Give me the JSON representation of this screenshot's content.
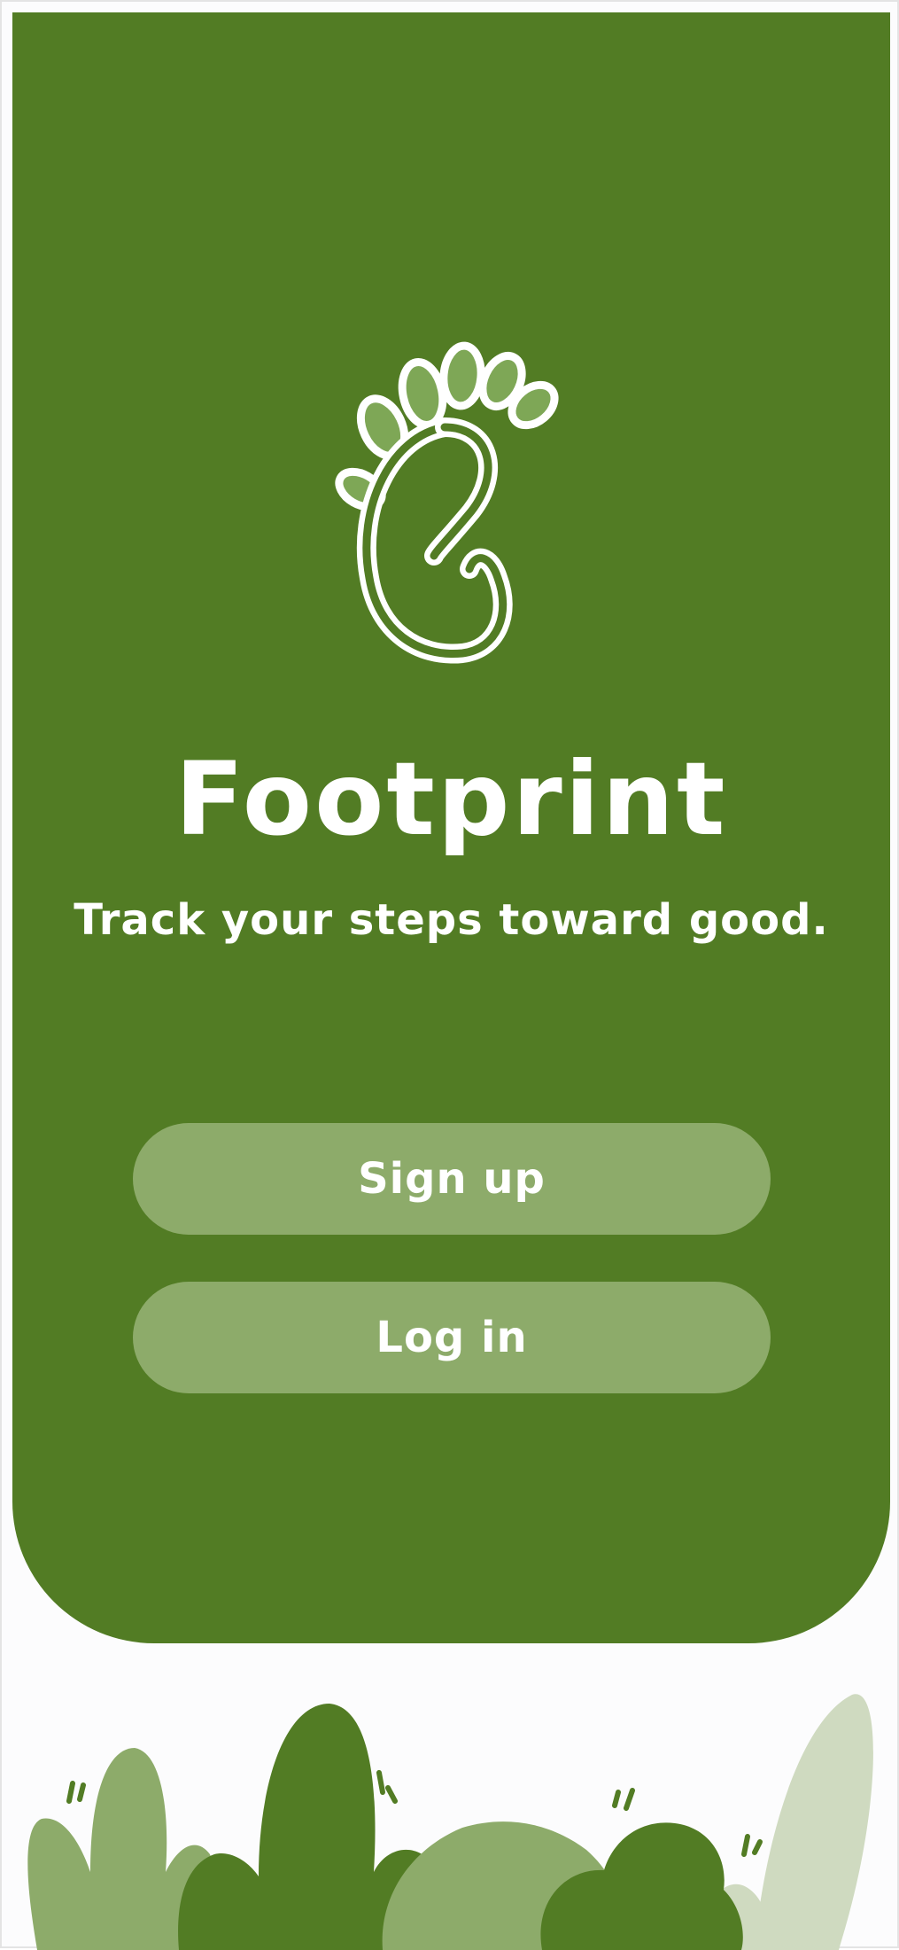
{
  "app": {
    "name": "Footprint",
    "tagline": "Track your steps toward good."
  },
  "actions": {
    "signup_label": "Sign up",
    "login_label": "Log in"
  },
  "icons": {
    "logo": "leafy-footprint-icon",
    "decoration": "shrubs-illustration"
  },
  "colors": {
    "primary_green": "#527c24",
    "button_green": "#8dab6a",
    "light_green": "#cfdac0",
    "background": "#fcfcfd",
    "text": "#ffffff"
  }
}
